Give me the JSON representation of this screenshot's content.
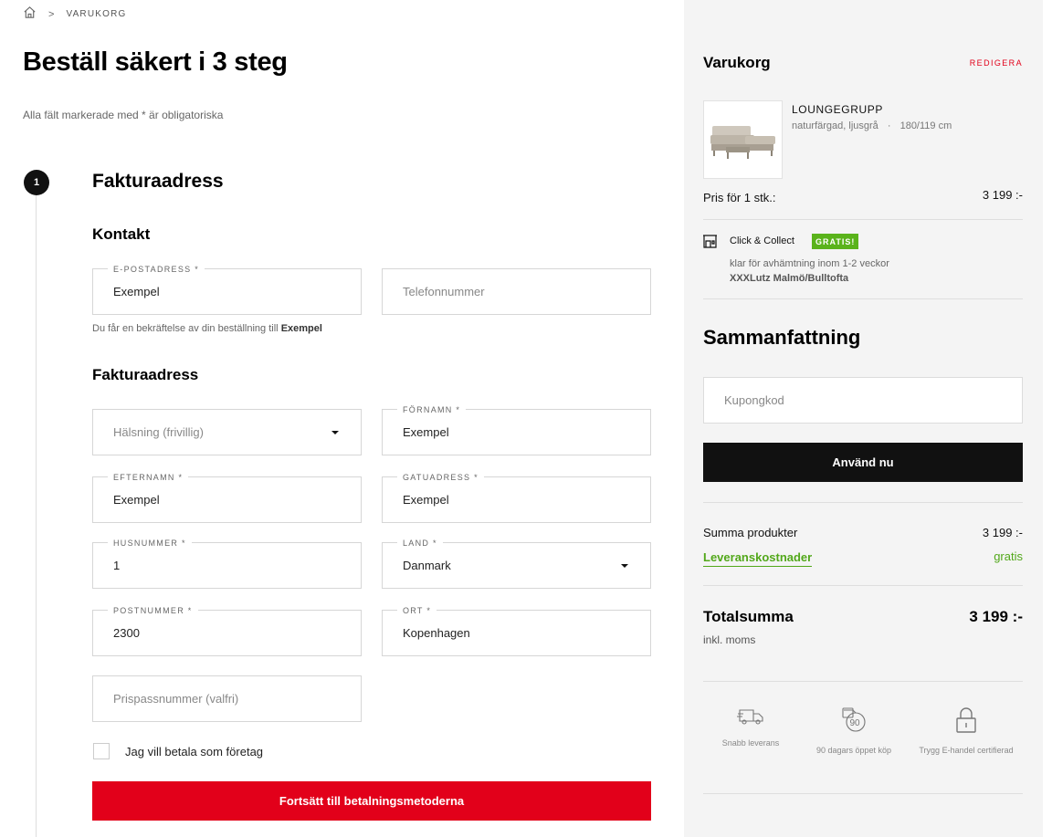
{
  "breadcrumb": {
    "current": "VARUKORG"
  },
  "page": {
    "title": "Beställ säkert i 3 steg",
    "required_note": "Alla fält markerade med * är obligatoriska"
  },
  "step": {
    "number": "1",
    "title": "Fakturaadress"
  },
  "contact": {
    "heading": "Kontakt",
    "email": {
      "label": "E-POSTADRESS *",
      "value": "Exempel"
    },
    "phone": {
      "placeholder": "Telefonnummer"
    },
    "confirm_text": "Du får en bekräftelse av din beställning till",
    "confirm_email": "Exempel"
  },
  "billing": {
    "heading": "Fakturaadress",
    "salutation": {
      "placeholder": "Hälsning (frivillig)"
    },
    "first_name": {
      "label": "FÖRNAMN *",
      "value": "Exempel"
    },
    "last_name": {
      "label": "EFTERNAMN *",
      "value": "Exempel"
    },
    "street": {
      "label": "GATUADRESS *",
      "value": "Exempel"
    },
    "house_number": {
      "label": "HUSNUMMER *",
      "value": "1"
    },
    "country": {
      "label": "LAND *",
      "value": "Danmark"
    },
    "postcode": {
      "label": "POSTNUMMER *",
      "value": "2300"
    },
    "city": {
      "label": "ORT *",
      "value": "Kopenhagen"
    },
    "price_pass": {
      "placeholder": "Prispassnummer (valfri)"
    },
    "company_checkbox": "Jag vill betala som företag",
    "continue_button": "Fortsätt till betalningsmetoderna"
  },
  "cart": {
    "title": "Varukorg",
    "edit_link": "REDIGERA",
    "product": {
      "name": "LOUNGEGRUPP",
      "variant": "naturfärgad, ljusgrå",
      "dimensions": "180/119 cm",
      "price_label": "Pris för 1 stk.:",
      "price": "3 199 :-"
    },
    "delivery": {
      "method": "Click & Collect",
      "badge": "GRATIS!",
      "availability": "klar för avhämtning inom 1-2 veckor",
      "store": "XXXLutz Malmö/Bulltofta"
    }
  },
  "summary": {
    "title": "Sammanfattning",
    "coupon_placeholder": "Kupongkod",
    "apply_button": "Använd nu",
    "products_label": "Summa produkter",
    "products_value": "3 199 :-",
    "shipping_label": "Leveranskostnader",
    "shipping_value": "gratis",
    "total_label": "Totalsumma",
    "total_value": "3 199 :-",
    "vat_note": "inkl. moms"
  },
  "trust_badges": [
    {
      "icon": "delivery-truck-icon",
      "label": "Snabb leverans"
    },
    {
      "icon": "90-days-return-icon",
      "label": "90 dagars öppet köp"
    },
    {
      "icon": "padlock-icon",
      "label": "Trygg E-handel certifierad"
    }
  ],
  "colors": {
    "accent_red": "#e2001a",
    "green": "#52a81a",
    "badge_green": "#5ab31b",
    "dark": "#111111",
    "sidebar_bg": "#f4f4f4"
  }
}
